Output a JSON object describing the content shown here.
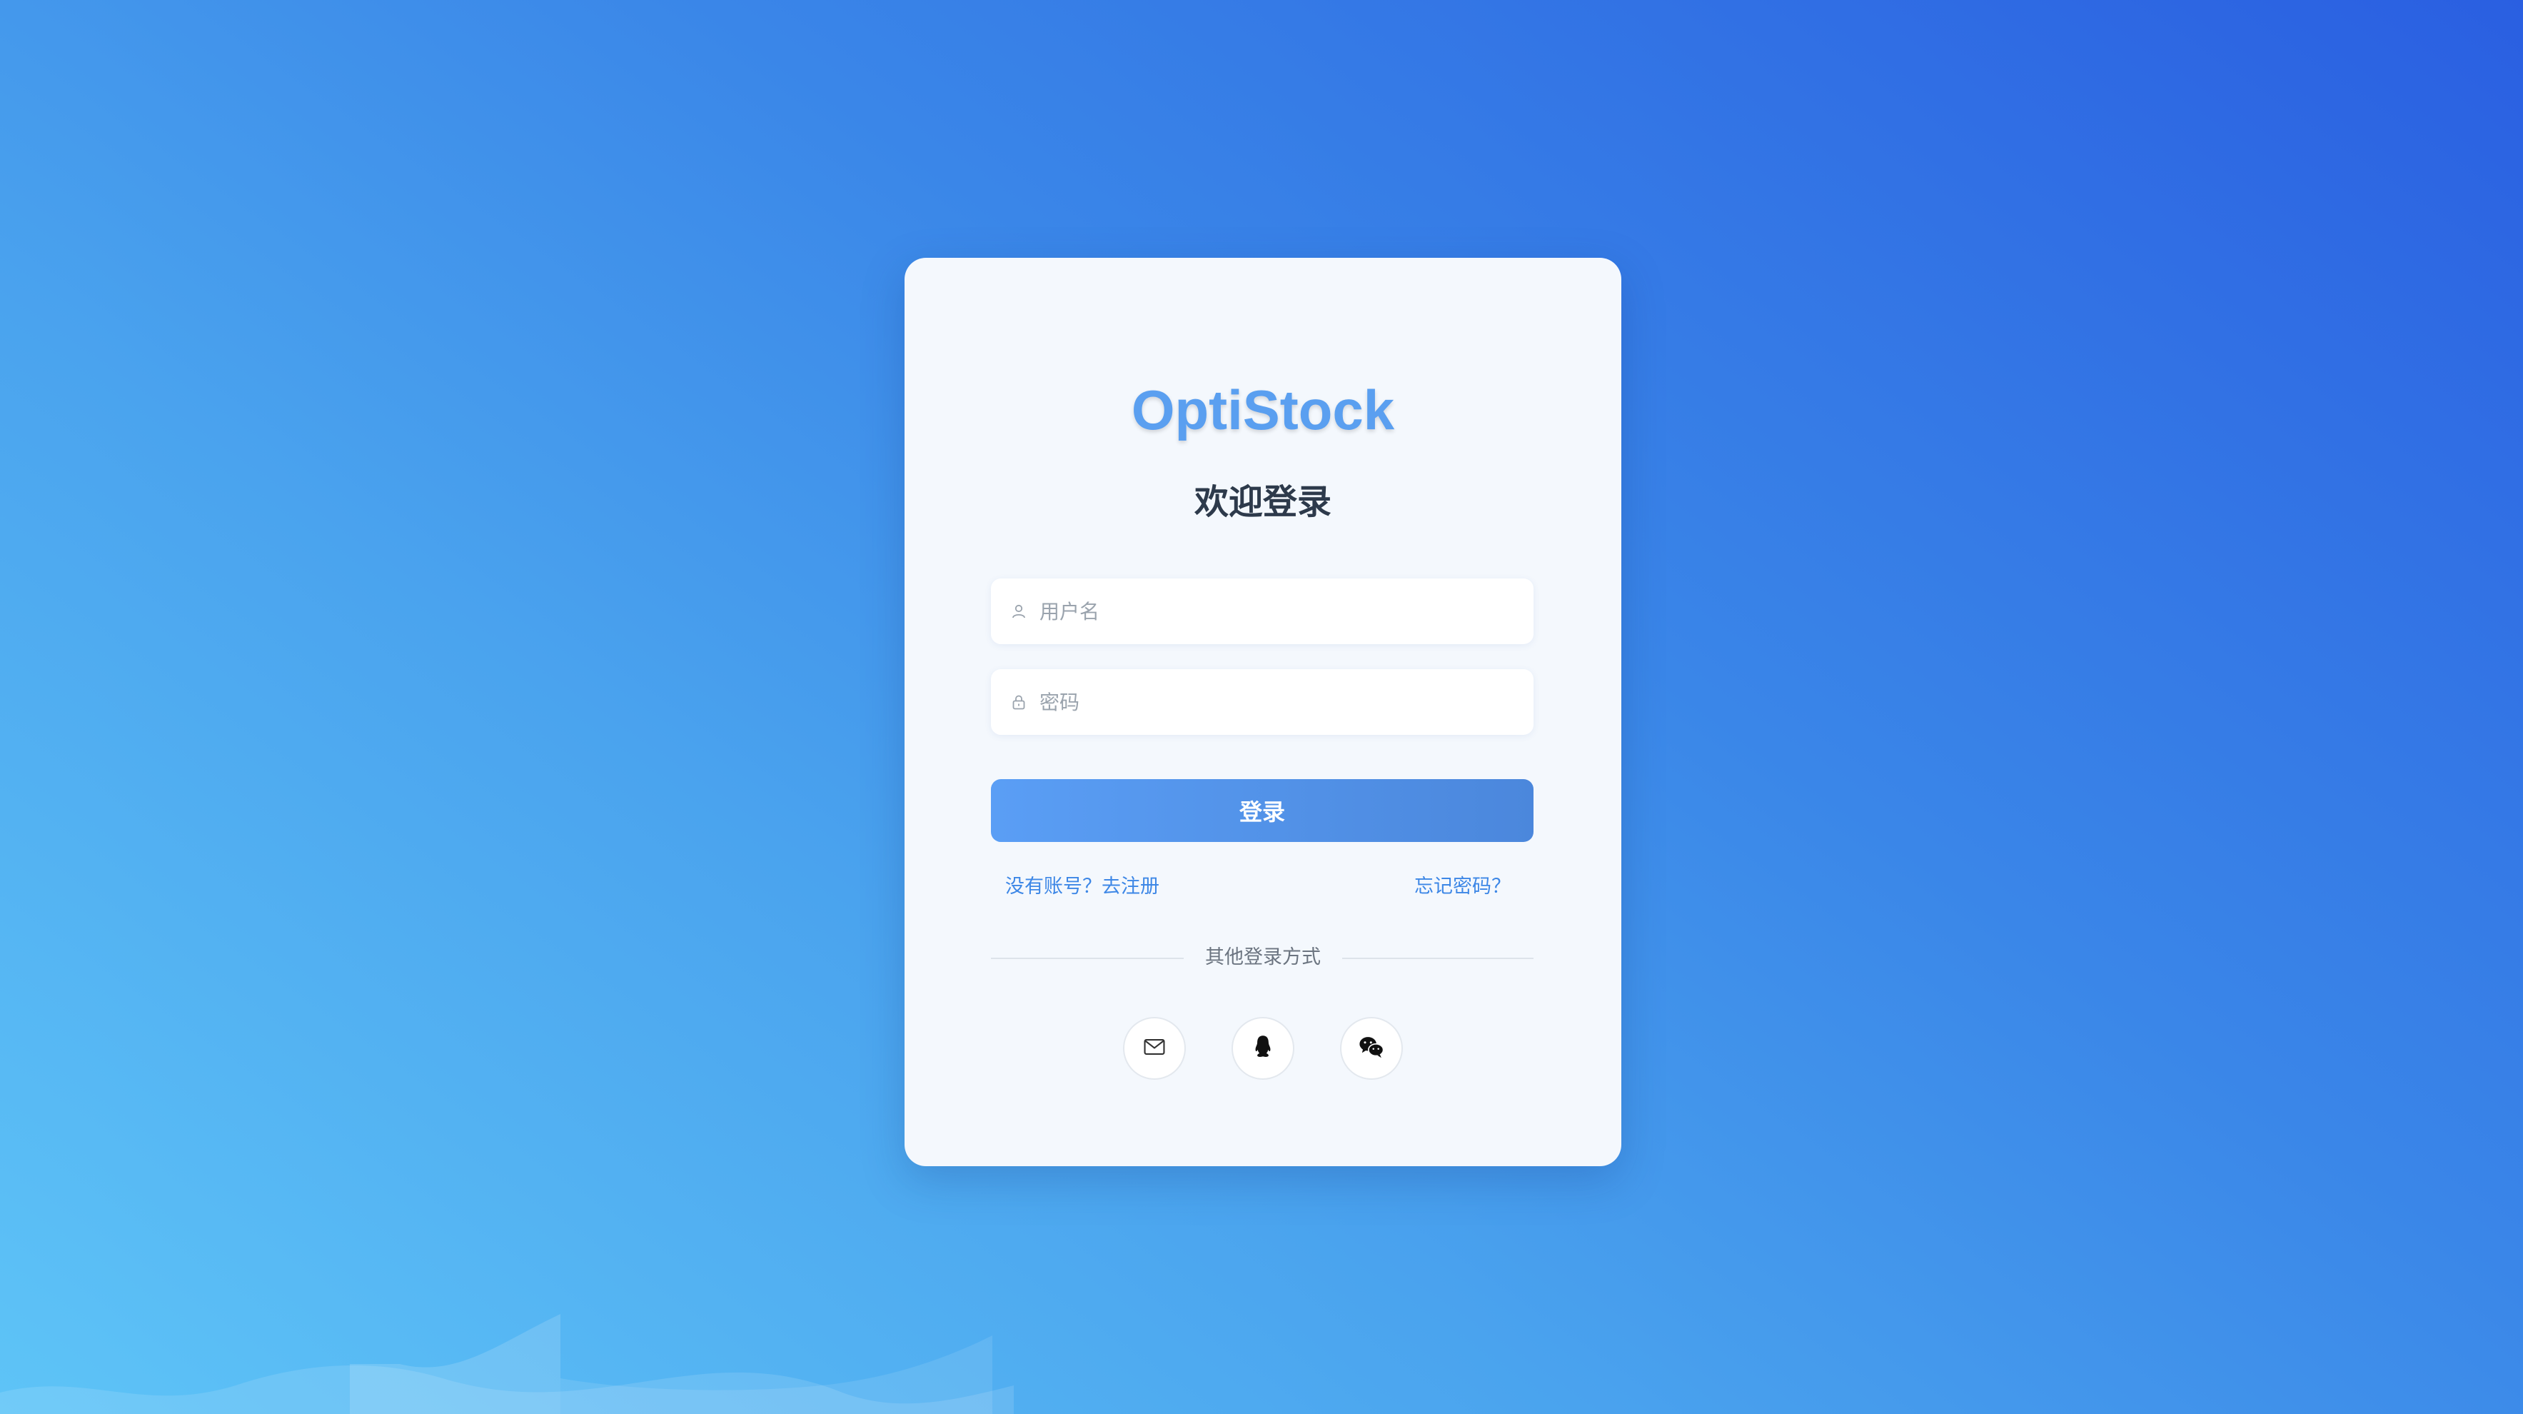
{
  "app": {
    "brand": "OptiStock",
    "welcome": "欢迎登录"
  },
  "form": {
    "username_placeholder": "用户名",
    "password_placeholder": "密码",
    "login_label": "登录"
  },
  "links": {
    "register": "没有账号？去注册",
    "forgot": "忘记密码？"
  },
  "alt_login": {
    "label": "其他登录方式",
    "options": [
      {
        "name": "email",
        "icon": "mail-icon"
      },
      {
        "name": "qq",
        "icon": "qq-penguin-icon"
      },
      {
        "name": "wechat",
        "icon": "wechat-icon"
      }
    ]
  },
  "colors": {
    "brand": "#5a9ff0",
    "accent": "#3d87e6",
    "button": "#5a9ef5",
    "background_start": "#5ec4f7",
    "background_end": "#2a5fe1"
  }
}
